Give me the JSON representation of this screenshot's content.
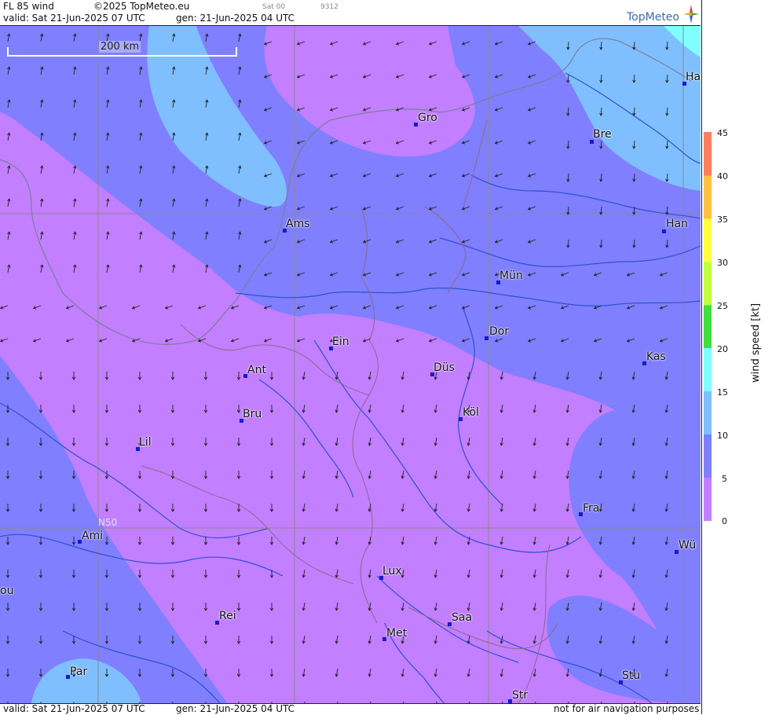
{
  "header": {
    "product": "FL 85 wind",
    "copyright": "©2025 TopMeteo.eu",
    "sat_code": "Sat 00",
    "code": "9312",
    "valid": "valid:  Sat  21-Jun-2025  07 UTC",
    "gen": "gen: 21-Jun-2025 04 UTC",
    "logo": "TopMeteo"
  },
  "footer": {
    "valid": "valid:  Sat  21-Jun-2025  07 UTC",
    "gen": "gen: 21-Jun-2025 04 UTC",
    "disclaimer": "not for air navigation purposes"
  },
  "scale": {
    "label": "200 km"
  },
  "grid": {
    "lat_label": "N50"
  },
  "legend": {
    "title": "wind  speed  [kt]",
    "ticks": [
      "45",
      "40",
      "35",
      "30",
      "25",
      "20",
      "15",
      "10",
      "5",
      "0"
    ],
    "colors": [
      "#c27fff",
      "#7f7fff",
      "#7fbfff",
      "#7fffff",
      "#3fdf3f",
      "#bfff3f",
      "#ffff3f",
      "#ffbf3f",
      "#ff7f5f"
    ]
  },
  "cities": [
    {
      "name": "Gro"
    },
    {
      "name": "Bre"
    },
    {
      "name": "Ha"
    },
    {
      "name": "Ams"
    },
    {
      "name": "Han"
    },
    {
      "name": "Mün"
    },
    {
      "name": "Dor"
    },
    {
      "name": "Ein"
    },
    {
      "name": "Kas"
    },
    {
      "name": "Düs"
    },
    {
      "name": "Ant"
    },
    {
      "name": "Köl"
    },
    {
      "name": "Bru"
    },
    {
      "name": "Lil"
    },
    {
      "name": "Fra"
    },
    {
      "name": "Ami"
    },
    {
      "name": "Wü"
    },
    {
      "name": "Lux"
    },
    {
      "name": "ou"
    },
    {
      "name": "Rei"
    },
    {
      "name": "Saa"
    },
    {
      "name": "Met"
    },
    {
      "name": "Par"
    },
    {
      "name": "Stu"
    },
    {
      "name": "Str"
    }
  ]
}
